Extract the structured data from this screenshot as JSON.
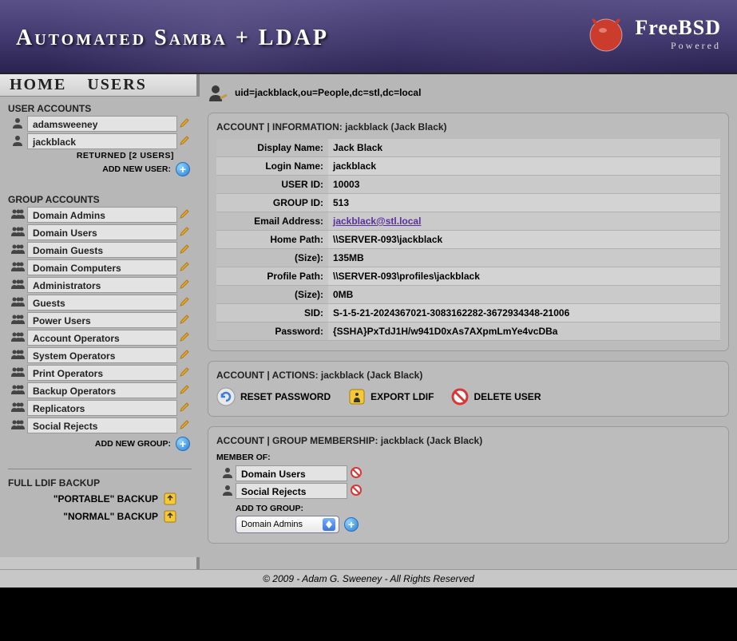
{
  "header": {
    "title": "Automated Samba + LDAP",
    "logo_main": "FreeBSD",
    "logo_sub": "Powered"
  },
  "topnav": {
    "home": "HOME",
    "users": "USERS"
  },
  "sidebar": {
    "user_accounts_heading": "USER ACCOUNTS",
    "users": [
      {
        "name": "adamsweeney"
      },
      {
        "name": "jackblack"
      }
    ],
    "returned_text": "RETURNED [2 USERS]",
    "add_user_label": "ADD NEW USER:",
    "group_accounts_heading": "GROUP ACCOUNTS",
    "groups": [
      {
        "name": "Domain Admins"
      },
      {
        "name": "Domain Users"
      },
      {
        "name": "Domain Guests"
      },
      {
        "name": "Domain Computers"
      },
      {
        "name": "Administrators"
      },
      {
        "name": "Guests"
      },
      {
        "name": "Power Users"
      },
      {
        "name": "Account Operators"
      },
      {
        "name": "System Operators"
      },
      {
        "name": "Print Operators"
      },
      {
        "name": "Backup Operators"
      },
      {
        "name": "Replicators"
      },
      {
        "name": "Social Rejects"
      }
    ],
    "add_group_label": "ADD NEW GROUP:",
    "backup_heading": "FULL LDIF BACKUP",
    "backup_portable": "\"PORTABLE\" BACKUP",
    "backup_normal": "\"NORMAL\" BACKUP"
  },
  "content": {
    "dn": "uid=jackblack,ou=People,dc=stl,dc=local",
    "info_title": "ACCOUNT | INFORMATION: jackblack (Jack Black)",
    "info_rows": [
      {
        "label": "Display Name:",
        "value": "Jack Black"
      },
      {
        "label": "Login Name:",
        "value": "jackblack"
      },
      {
        "label": "USER ID:",
        "value": "10003"
      },
      {
        "label": "GROUP ID:",
        "value": "513"
      },
      {
        "label": "Email Address:",
        "value": "jackblack@stl.local",
        "is_link": true
      },
      {
        "label": "Home Path:",
        "value": "\\\\SERVER-093\\jackblack"
      },
      {
        "label": "(Size):",
        "value": "135MB"
      },
      {
        "label": "Profile Path:",
        "value": "\\\\SERVER-093\\profiles\\jackblack"
      },
      {
        "label": "(Size):",
        "value": "0MB"
      },
      {
        "label": "SID:",
        "value": "S-1-5-21-2024367021-3083162282-3672934348-21006"
      },
      {
        "label": "Password:",
        "value": "{SSHA}PxTdJ1H/w941D0xAs7AXpmLmYe4vcDBa"
      }
    ],
    "actions_title": "ACCOUNT | ACTIONS: jackblack (Jack Black)",
    "action_reset": "RESET PASSWORD",
    "action_export": "EXPORT LDIF",
    "action_delete": "DELETE USER",
    "membership_title": "ACCOUNT | GROUP MEMBERSHIP: jackblack (Jack Black)",
    "member_of_label": "MEMBER OF:",
    "memberships": [
      {
        "name": "Domain Users"
      },
      {
        "name": "Social Rejects"
      }
    ],
    "add_to_group_label": "ADD TO GROUP:",
    "add_to_group_selected": "Domain Admins"
  },
  "footer": {
    "text": "© 2009 - Adam G. Sweeney - All Rights Reserved"
  }
}
